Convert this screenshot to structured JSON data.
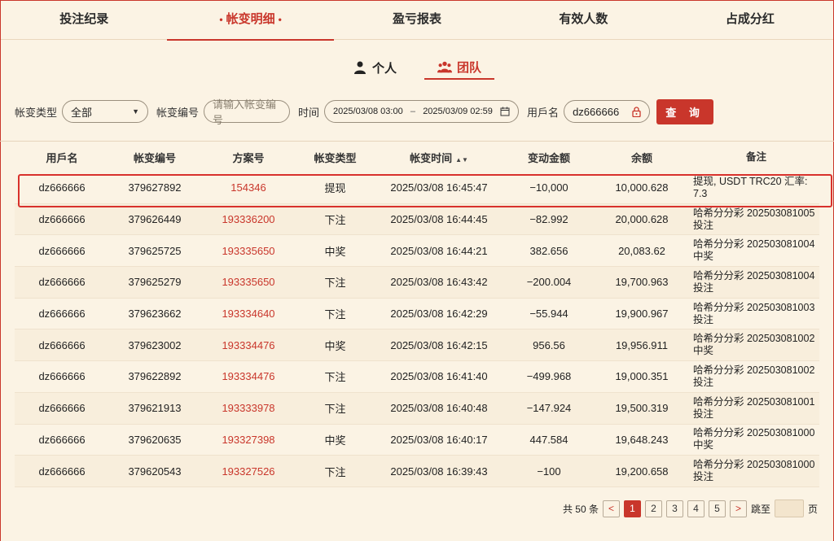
{
  "top_tabs": [
    {
      "label": "投注纪录"
    },
    {
      "label": "帐变明细",
      "active": true
    },
    {
      "label": "盈亏报表"
    },
    {
      "label": "有效人数"
    },
    {
      "label": "占成分红"
    }
  ],
  "sub_tabs": [
    {
      "label": "个人",
      "icon": "person-icon"
    },
    {
      "label": "团队",
      "icon": "team-icon",
      "active": true
    }
  ],
  "filters": {
    "type_label": "帐变类型",
    "type_value": "全部",
    "id_label": "帐变编号",
    "id_placeholder": "请输入帐变编号",
    "time_label": "时间",
    "time_start": "2025/03/08 03:00",
    "time_sep": "–",
    "time_end": "2025/03/09 02:59",
    "user_label": "用戶名",
    "user_value": "dz666666",
    "query_label": "查 询"
  },
  "table": {
    "headers": [
      "用戶名",
      "帐变编号",
      "方案号",
      "帐变类型",
      "帐变时间",
      "变动金额",
      "余额",
      "备注"
    ],
    "rows": [
      {
        "user": "dz666666",
        "id": "379627892",
        "plan": "154346",
        "type": "提现",
        "time": "2025/03/08 16:45:47",
        "amount": "−10,000",
        "balance": "10,000.628",
        "note": "提现, USDT TRC20 汇率: 7.3"
      },
      {
        "user": "dz666666",
        "id": "379626449",
        "plan": "193336200",
        "type": "下注",
        "time": "2025/03/08 16:44:45",
        "amount": "−82.992",
        "balance": "20,000.628",
        "note": "哈希分分彩 202503081005 投注"
      },
      {
        "user": "dz666666",
        "id": "379625725",
        "plan": "193335650",
        "type": "中奖",
        "time": "2025/03/08 16:44:21",
        "amount": "382.656",
        "balance": "20,083.62",
        "note": "哈希分分彩 202503081004 中奖"
      },
      {
        "user": "dz666666",
        "id": "379625279",
        "plan": "193335650",
        "type": "下注",
        "time": "2025/03/08 16:43:42",
        "amount": "−200.004",
        "balance": "19,700.963",
        "note": "哈希分分彩 202503081004 投注"
      },
      {
        "user": "dz666666",
        "id": "379623662",
        "plan": "193334640",
        "type": "下注",
        "time": "2025/03/08 16:42:29",
        "amount": "−55.944",
        "balance": "19,900.967",
        "note": "哈希分分彩 202503081003 投注"
      },
      {
        "user": "dz666666",
        "id": "379623002",
        "plan": "193334476",
        "type": "中奖",
        "time": "2025/03/08 16:42:15",
        "amount": "956.56",
        "balance": "19,956.911",
        "note": "哈希分分彩 202503081002 中奖"
      },
      {
        "user": "dz666666",
        "id": "379622892",
        "plan": "193334476",
        "type": "下注",
        "time": "2025/03/08 16:41:40",
        "amount": "−499.968",
        "balance": "19,000.351",
        "note": "哈希分分彩 202503081002 投注"
      },
      {
        "user": "dz666666",
        "id": "379621913",
        "plan": "193333978",
        "type": "下注",
        "time": "2025/03/08 16:40:48",
        "amount": "−147.924",
        "balance": "19,500.319",
        "note": "哈希分分彩 202503081001 投注"
      },
      {
        "user": "dz666666",
        "id": "379620635",
        "plan": "193327398",
        "type": "中奖",
        "time": "2025/03/08 16:40:17",
        "amount": "447.584",
        "balance": "19,648.243",
        "note": "哈希分分彩 202503081000 中奖"
      },
      {
        "user": "dz666666",
        "id": "379620543",
        "plan": "193327526",
        "type": "下注",
        "time": "2025/03/08 16:39:43",
        "amount": "−100",
        "balance": "19,200.658",
        "note": "哈希分分彩 202503081000 投注"
      }
    ]
  },
  "pager": {
    "total_text": "共 50 条",
    "pages": [
      "1",
      "2",
      "3",
      "4",
      "5"
    ],
    "current": "1",
    "prev": "<",
    "next": ">",
    "jump_label": "跳至",
    "page_unit": "页"
  },
  "colors": {
    "accent": "#c9362b",
    "background": "#fbf3e4"
  }
}
